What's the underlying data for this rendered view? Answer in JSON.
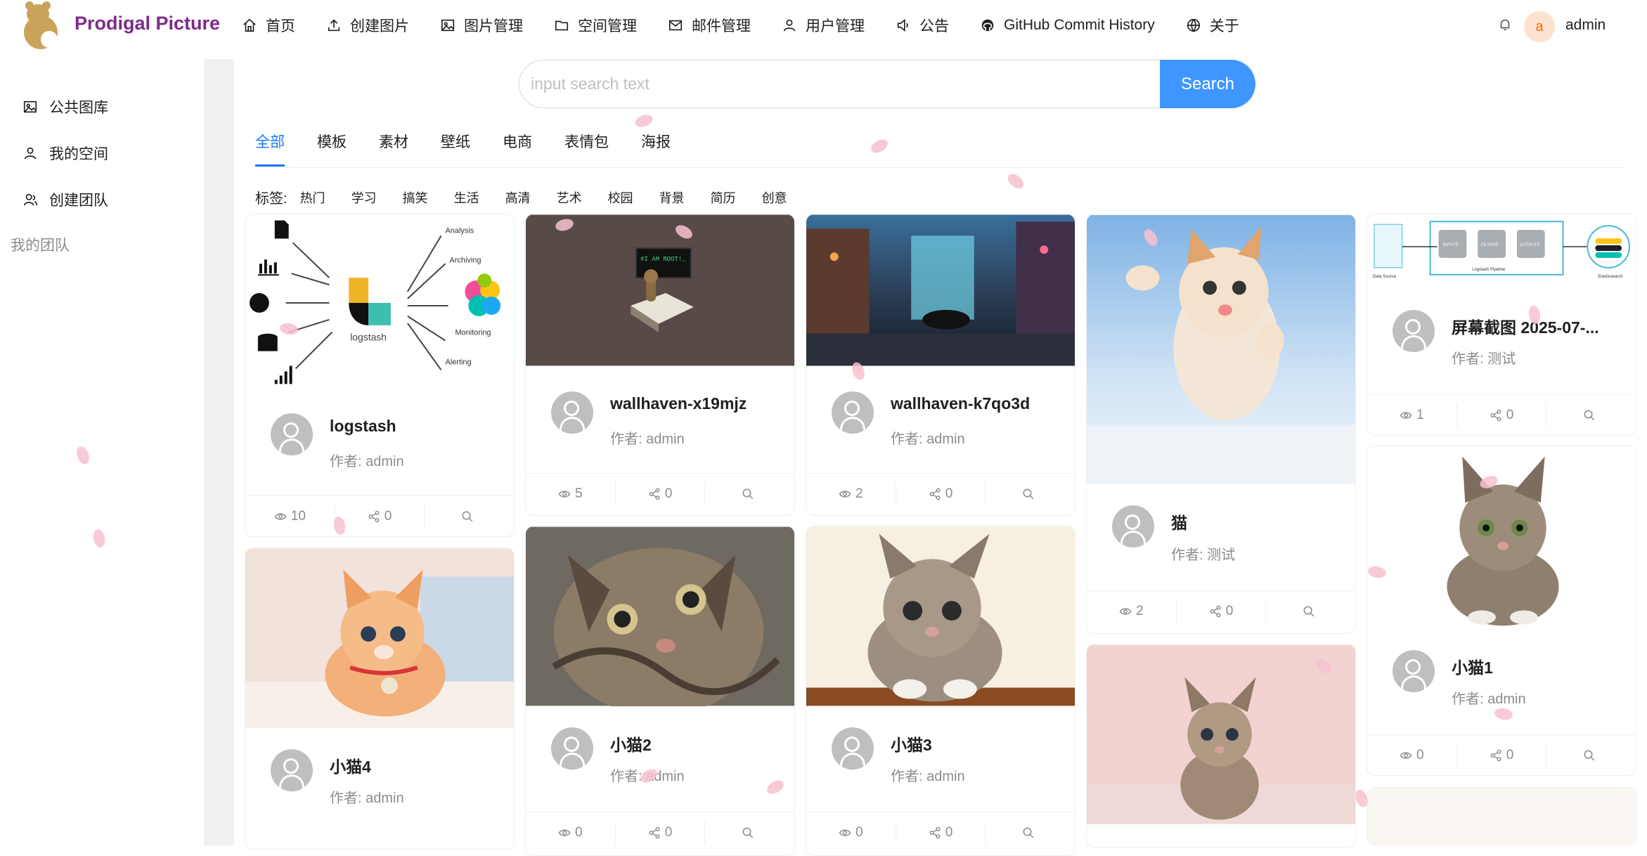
{
  "header": {
    "brand": "Prodigal Picture",
    "nav": [
      {
        "label": "首页",
        "icon": "home-icon"
      },
      {
        "label": "创建图片",
        "icon": "upload-icon"
      },
      {
        "label": "图片管理",
        "icon": "picture-icon"
      },
      {
        "label": "空间管理",
        "icon": "folder-icon"
      },
      {
        "label": "邮件管理",
        "icon": "mail-icon"
      },
      {
        "label": "用户管理",
        "icon": "user-icon"
      },
      {
        "label": "公告",
        "icon": "sound-icon"
      },
      {
        "label": "GitHub Commit History",
        "icon": "github-icon"
      },
      {
        "label": "关于",
        "icon": "globe-icon"
      }
    ],
    "user": {
      "avatar_letter": "a",
      "name": "admin"
    }
  },
  "sidebar": {
    "items": [
      {
        "label": "公共图库",
        "icon": "picture-icon"
      },
      {
        "label": "我的空间",
        "icon": "user-icon"
      },
      {
        "label": "创建团队",
        "icon": "team-icon"
      }
    ],
    "group_label": "我的团队"
  },
  "search": {
    "placeholder": "input search text",
    "button": "Search"
  },
  "tabs": [
    "全部",
    "模板",
    "素材",
    "壁纸",
    "电商",
    "表情包",
    "海报"
  ],
  "tags": {
    "label": "标签:",
    "items": [
      "热门",
      "学习",
      "搞笑",
      "生活",
      "高清",
      "艺术",
      "校园",
      "背景",
      "简历",
      "创意"
    ]
  },
  "cards": [
    {
      "title": "logstash",
      "author": "作者: admin",
      "views": "10",
      "shares": "0"
    },
    {
      "title": "wallhaven-x19mjz",
      "author": "作者: admin",
      "views": "5",
      "shares": "0"
    },
    {
      "title": "wallhaven-k7qo3d",
      "author": "作者: admin",
      "views": "2",
      "shares": "0"
    },
    {
      "title": "猫",
      "author": "作者: 测试",
      "views": "2",
      "shares": "0"
    },
    {
      "title": "屏幕截图 2025-07-...",
      "author": "作者: 测试",
      "views": "1",
      "shares": "0"
    },
    {
      "title": "小猫4",
      "author": "作者: admin"
    },
    {
      "title": "小猫2",
      "author": "作者: admin",
      "views": "0",
      "shares": "0"
    },
    {
      "title": "小猫3",
      "author": "作者: admin",
      "views": "0",
      "shares": "0"
    },
    {
      "title": "小猫1",
      "author": "作者: admin",
      "views": "0",
      "shares": "0"
    }
  ],
  "logstash_diagram": {
    "inputs": [],
    "center": "logstash",
    "outputs": [
      "Analysis",
      "Archiving",
      "Monitoring",
      "Alerting"
    ]
  },
  "pipeline_diagram": {
    "labels": [
      "Data Source",
      "INPUTS",
      "FILTERS",
      "OUTPUTS",
      "Logstash Pipeline",
      "Elasticsearch"
    ]
  },
  "terminal_text": "#I AM ROOT!_"
}
